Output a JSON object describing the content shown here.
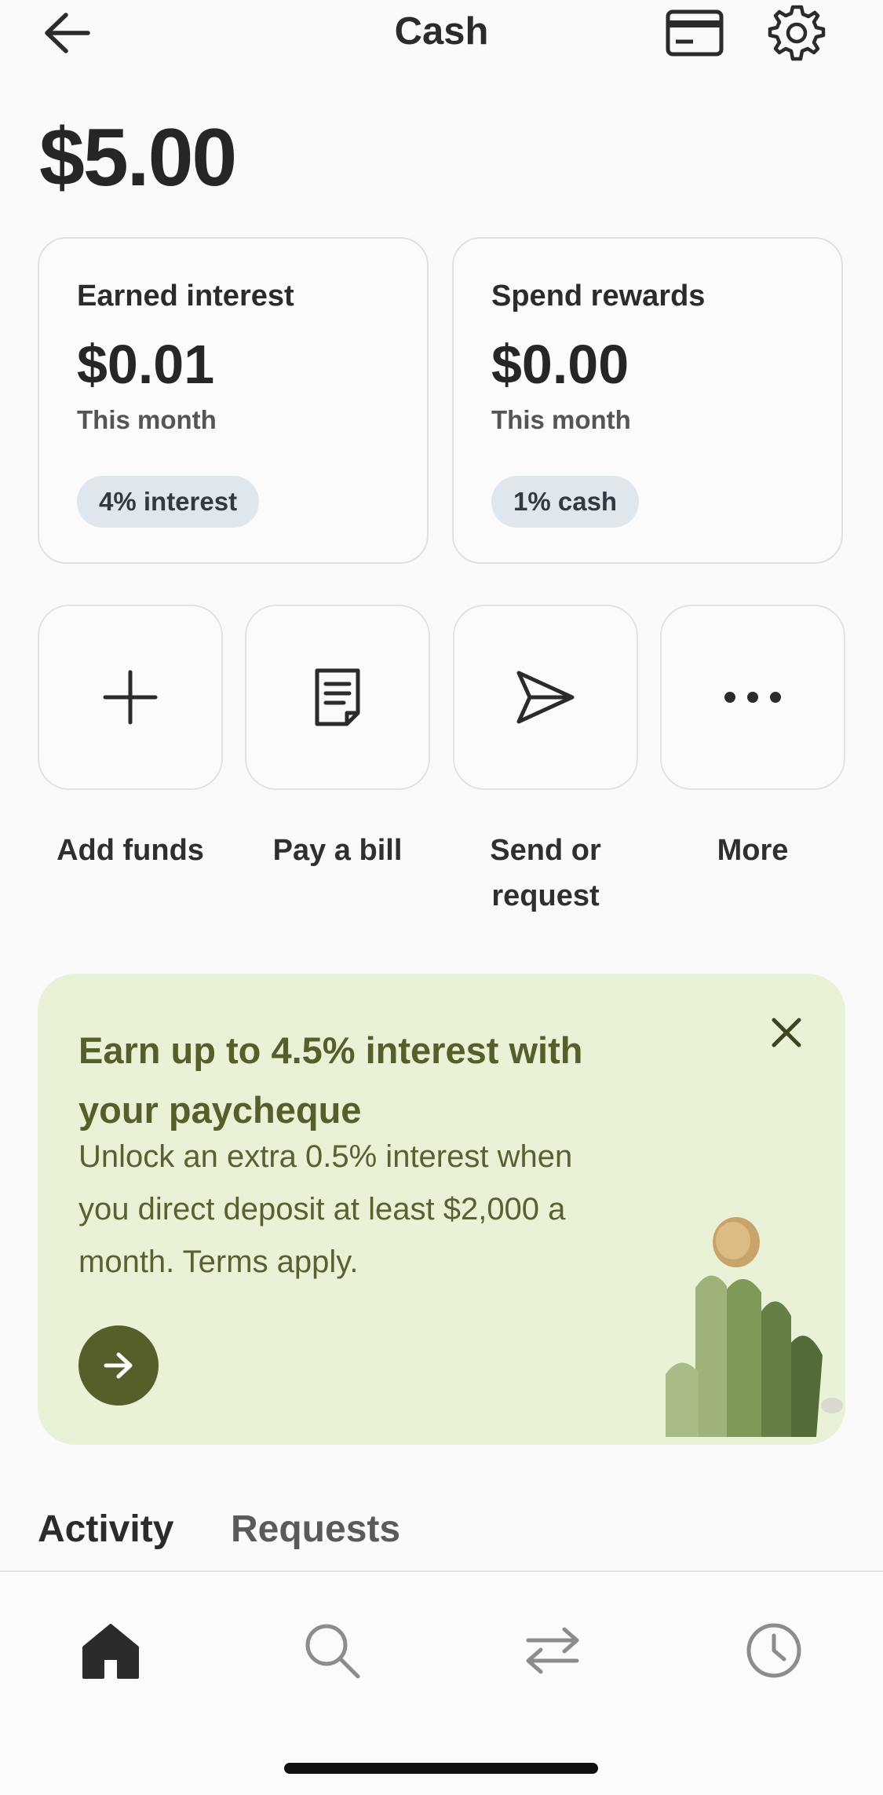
{
  "header": {
    "title": "Cash",
    "back_icon": "arrow-left-icon",
    "card_icon": "credit-card-icon",
    "settings_icon": "gear-icon"
  },
  "balance": "$5.00",
  "cards": [
    {
      "label": "Earned interest",
      "value": "$0.01",
      "period": "This month",
      "pill": "4% interest"
    },
    {
      "label": "Spend rewards",
      "value": "$0.00",
      "period": "This month",
      "pill": "1% cash"
    }
  ],
  "actions": [
    {
      "label": "Add funds",
      "icon": "plus-icon"
    },
    {
      "label": "Pay a bill",
      "icon": "document-icon"
    },
    {
      "label": "Send or request",
      "icon": "send-icon"
    },
    {
      "label": "More",
      "icon": "more-dots-icon"
    }
  ],
  "promo": {
    "title": "Earn up to 4.5% interest with your paycheque",
    "body": "Unlock an extra 0.5% interest when you direct deposit at least $2,000 a month. Terms apply.",
    "cta_icon": "arrow-right-icon",
    "close_icon": "close-icon"
  },
  "tabs": [
    {
      "label": "Activity",
      "active": true
    },
    {
      "label": "Requests",
      "active": false
    }
  ],
  "bottom_nav": [
    {
      "icon": "home-icon",
      "active": true
    },
    {
      "icon": "search-icon",
      "active": false
    },
    {
      "icon": "transfer-icon",
      "active": false
    },
    {
      "icon": "history-clock-icon",
      "active": false
    }
  ],
  "colors": {
    "background": "#fafafa",
    "promo_background": "#e9f1d7",
    "promo_accent": "#545f2a",
    "pill_background": "#dfe7ed"
  }
}
